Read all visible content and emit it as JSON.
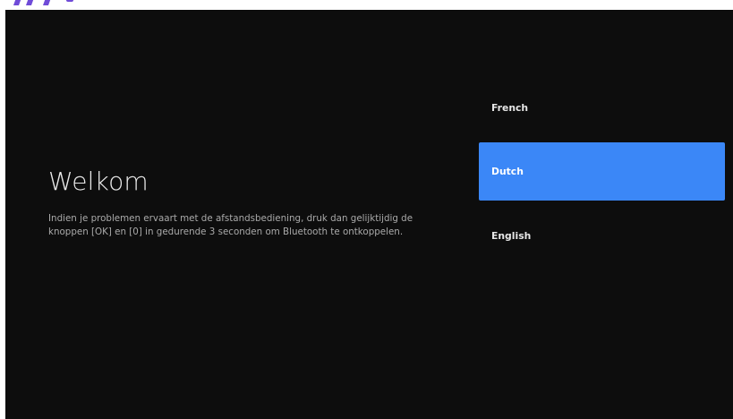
{
  "screen": {
    "welcome": {
      "title": "Welkom",
      "message": "Indien je problemen ervaart met de afstandsbediening, druk dan gelijktijdig de knoppen [OK] en [0] in gedurende 3 seconden om Bluetooth te ontkoppelen."
    },
    "languages": [
      {
        "label": "French",
        "selected": false
      },
      {
        "label": "Dutch",
        "selected": true
      },
      {
        "label": "English",
        "selected": false
      }
    ],
    "colors": {
      "background": "#0d0d0d",
      "selected": "#3b87f7",
      "logo_fragment": "#6f4bd8"
    },
    "logo_fragment": "partially-cropped-logo-icon"
  }
}
